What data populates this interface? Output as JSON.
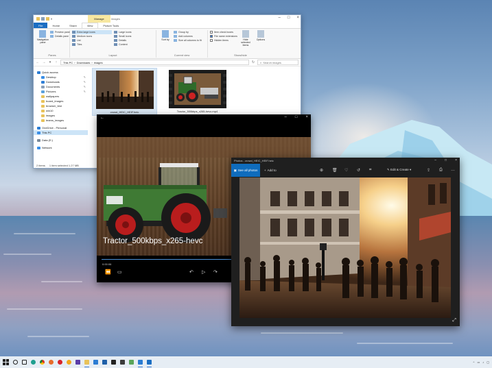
{
  "explorer": {
    "title": "images",
    "context_tab": "Manage",
    "context_tab_sub": "Picture Tools",
    "tabs": [
      "File",
      "Home",
      "Share",
      "View",
      "Picture Tools"
    ],
    "ribbon": {
      "panes": {
        "nav_pane": "Navigation pane",
        "preview_pane": "Preview pane",
        "details_pane": "Details pane",
        "group": "Panes"
      },
      "layout": {
        "items": [
          "Extra large icons",
          "Large icons",
          "Medium icons",
          "Small icons",
          "List",
          "Details",
          "Tiles",
          "Content"
        ],
        "group": "Layout"
      },
      "current_view": {
        "sort_by": "Sort by",
        "group_by": "Group by",
        "add_columns": "Add columns",
        "size_columns": "Size all columns to fit",
        "group": "Current view"
      },
      "show_hide": {
        "item_checkboxes": "Item check boxes",
        "file_extensions": "File name extensions",
        "hidden_items": "Hidden items",
        "hide_selected": "Hide selected items",
        "options": "Options",
        "group": "Show/hide"
      }
    },
    "address": {
      "crumbs": [
        "This PC",
        "Downloads",
        "images"
      ],
      "search_placeholder": "Search images"
    },
    "nav": [
      {
        "label": "Quick access",
        "sub": false,
        "color": "#2b7cd3"
      },
      {
        "label": "Desktop",
        "sub": true,
        "color": "#3a8ee6",
        "pin": true
      },
      {
        "label": "Downloads",
        "sub": true,
        "color": "#2f7fd6",
        "pin": true
      },
      {
        "label": "Documents",
        "sub": true,
        "color": "#8aa0b8",
        "pin": true
      },
      {
        "label": "Pictures",
        "sub": true,
        "color": "#5aa0dc",
        "pin": true
      },
      {
        "label": "wallpapers",
        "sub": true,
        "color": "#e8c25a",
        "pin": false
      },
      {
        "label": "board_images",
        "sub": true,
        "color": "#e8c25a",
        "pin": false
      },
      {
        "label": "browser_test",
        "sub": true,
        "color": "#e8c25a",
        "pin": false
      },
      {
        "label": "win10",
        "sub": true,
        "color": "#e8c25a",
        "pin": false
      },
      {
        "label": "images",
        "sub": true,
        "color": "#e8c25a",
        "pin": false
      },
      {
        "label": "teams_images",
        "sub": true,
        "color": "#e8c25a",
        "pin": false
      },
      {
        "label": "OneDrive - Personal",
        "sub": false,
        "color": "#2b7cd3",
        "gap": true
      },
      {
        "label": "This PC",
        "sub": false,
        "color": "#3a8ee6",
        "selected": true
      },
      {
        "label": "Data (E:)",
        "sub": false,
        "color": "#7a8a9a",
        "gap": true
      },
      {
        "label": "Network",
        "sub": false,
        "color": "#3a8ee6",
        "gap": true
      }
    ],
    "files": [
      {
        "name": "crowd_HEIC_HEIF.heic",
        "selected": true
      },
      {
        "name": "Tractor_500kbps_x265-hevc.mp4",
        "selected": false
      }
    ],
    "status": {
      "count": "2 items",
      "selection": "1 item selected  1.27 MB"
    }
  },
  "player": {
    "video_title": "Tractor_500kbps_x265-hevc",
    "time": "0:00:06",
    "progress": 0.7,
    "icons": [
      "captions-icon",
      "chat-icon",
      "rewind-icon",
      "play-icon",
      "forward-icon",
      "fullscreen-icon"
    ]
  },
  "photos": {
    "title": "Photos - crowd_HEIC_HEIF.heic",
    "see_all": "See all photos",
    "add_to": "Add to",
    "edit": "Edit & Create"
  },
  "taskbar": {
    "apps": [
      "search",
      "task-view",
      "edge",
      "chrome",
      "firefox",
      "opera",
      "files",
      "explorer",
      "store",
      "mail",
      "photos",
      "terminal",
      "settings",
      "player",
      "photos-app",
      "video"
    ],
    "tray_time": "",
    "accent": "#0f6cbd"
  }
}
